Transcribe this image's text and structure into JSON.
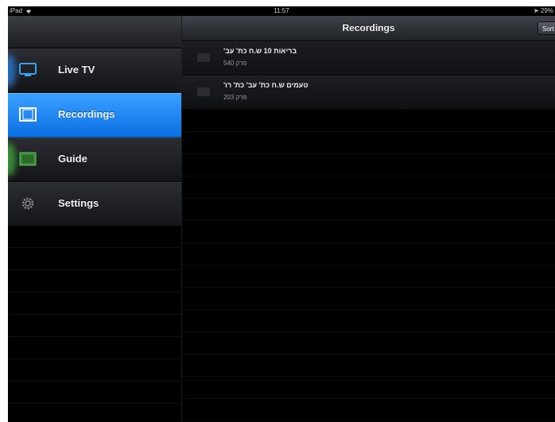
{
  "status_bar": {
    "device": "iPad",
    "time": "11:57",
    "battery": "29%"
  },
  "sidebar": {
    "items": [
      {
        "label": "Live TV",
        "icon": "tv-icon",
        "active": false
      },
      {
        "label": "Recordings",
        "icon": "film-icon",
        "active": true
      },
      {
        "label": "Guide",
        "icon": "guide-icon",
        "active": false
      },
      {
        "label": "Settings",
        "icon": "gear-icon",
        "active": false
      }
    ]
  },
  "main": {
    "title": "Recordings",
    "sort_label": "Sort",
    "recordings": [
      {
        "title": "בריאות 10 ש.ח כת' עב'",
        "subtitle": "פרק 540"
      },
      {
        "title": "טעמים  ש.ח כת' עב' כת' רו'",
        "subtitle": "פרק 203"
      }
    ]
  },
  "colors": {
    "accent": "#1e86f5",
    "background": "#000000"
  }
}
